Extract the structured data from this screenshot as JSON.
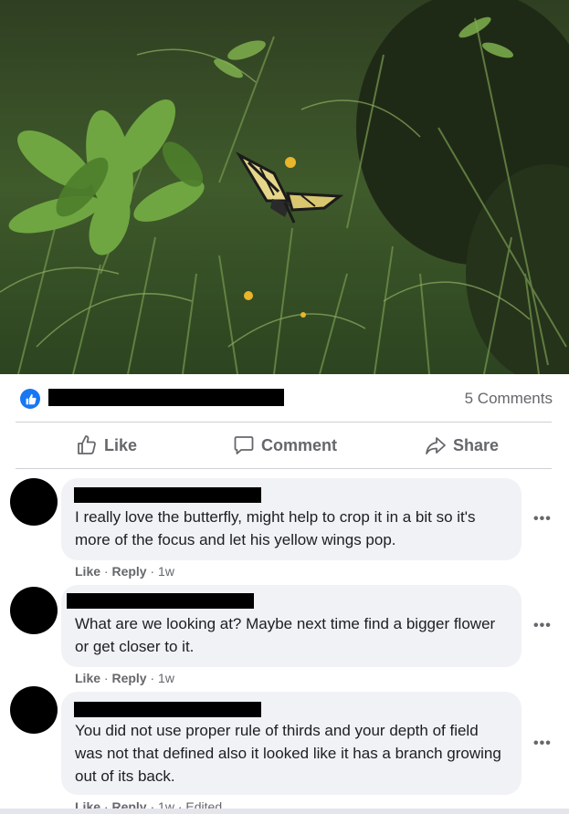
{
  "post": {
    "photo_icon": "butterfly-photo",
    "reactions_icon": "thumbs-up-icon",
    "comment_count": "5 Comments"
  },
  "actions": {
    "like": "Like",
    "comment": "Comment",
    "share": "Share"
  },
  "comments": [
    {
      "text": "I really love the butterfly, might help to crop it in a bit so it's more of the focus and let his yellow wings pop.",
      "like": "Like",
      "reply": "Reply",
      "sep": "·",
      "time": "1w",
      "edited": ""
    },
    {
      "text": "What are we looking at? Maybe next time find a bigger flower or get closer to it.",
      "like": "Like",
      "reply": "Reply",
      "sep": "·",
      "time": "1w",
      "edited": ""
    },
    {
      "text": "You did not use proper rule of thirds and your depth of field was not that defined also it looked like it has a branch growing out of its back.",
      "like": "Like",
      "reply": "Reply",
      "sep": "·",
      "time": "1w",
      "edited": "Edited"
    }
  ],
  "colors": {
    "accent": "#1877f2",
    "bubble": "#f0f2f5",
    "secondary_text": "#65676b"
  }
}
